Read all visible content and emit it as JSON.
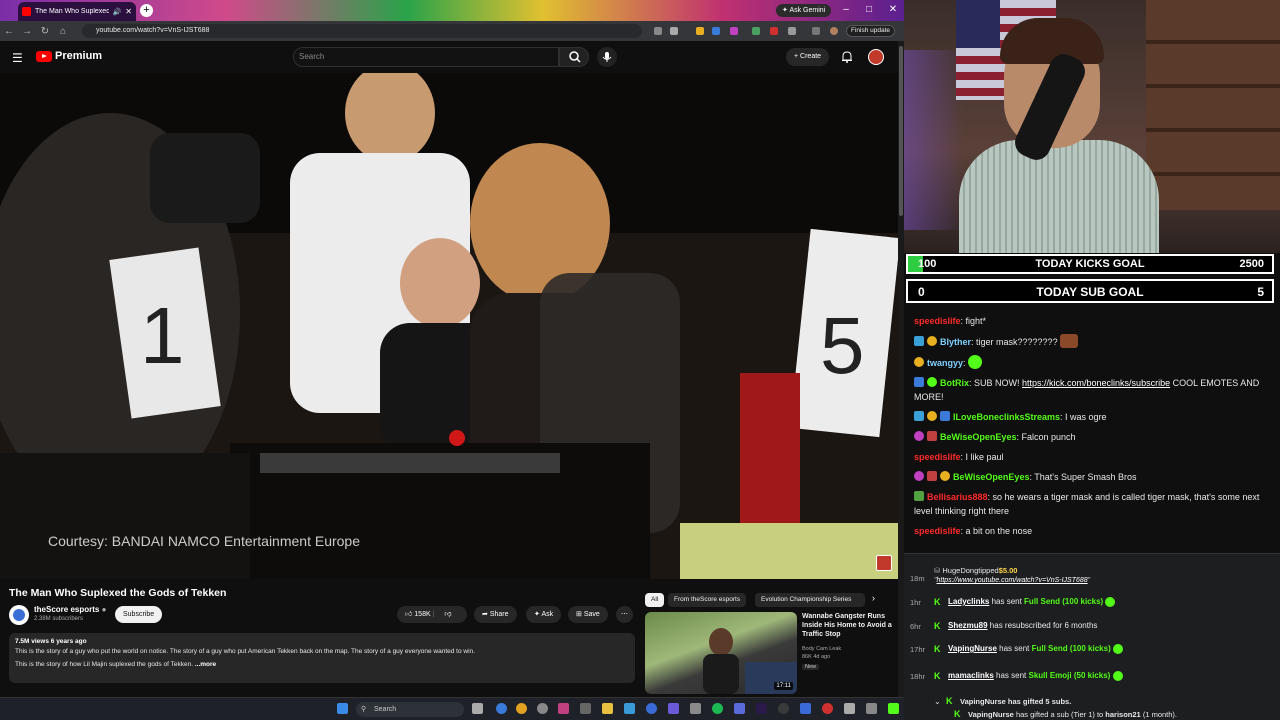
{
  "browser": {
    "tab_title": "The Man Who Suplexed the",
    "gemini_label": "Ask Gemini",
    "url": "youtube.com/watch?v=VnS-IJST688",
    "finish_update": "Finish update"
  },
  "youtube": {
    "logo_text": "Premium",
    "search_placeholder": "Search",
    "create_label": "Create",
    "video_overlay_text": "Courtesy: BANDAI NAMCO Entertainment Europe",
    "video_title": "The Man Who Suplexed the Gods of Tekken",
    "channel_name": "theScore esports",
    "channel_subs": "2.38M subscribers",
    "subscribe_label": "Subscribe",
    "like_count": "158K",
    "share_label": "Share",
    "ask_label": "Ask",
    "save_label": "Save",
    "desc_meta": "7.5M views  6 years ago",
    "desc_line1": "This is the story of a guy who put the world on notice. The story of a guy who put American Tekken back on the map. The story of a guy everyone wanted to win.",
    "desc_line2": "This is the story of how Lil Majin suplexed the gods of Tekken.",
    "desc_more": "...more",
    "chips": [
      "All",
      "From theScore esports",
      "Evolution Championship Series"
    ],
    "related": {
      "title": "Wannabe Gangster Runs Inside His Home to Avoid a Traffic Stop",
      "channel": "Body Cam Leak",
      "stats": "86K  4d ago",
      "badge": "New",
      "duration": "17:11"
    }
  },
  "taskbar": {
    "search_placeholder": "Search"
  },
  "goals": {
    "kicks": {
      "current": "100",
      "label": "TODAY KICKS GOAL",
      "target": "2500",
      "progress": 0.04
    },
    "subs": {
      "current": "0",
      "label": "TODAY SUB GOAL",
      "target": "5"
    }
  },
  "chat": [
    {
      "user": "speedislife",
      "color": "#ff2a2a",
      "text": ": fight*"
    },
    {
      "user": "Blyther",
      "color": "#7fd0ff",
      "text": ": tiger mask????????"
    },
    {
      "user": "twangyy",
      "color": "#7fd0ff",
      "text": ":"
    },
    {
      "user": "BotRix",
      "color": "#53fc18",
      "text": ": SUB NOW! ",
      "link": "https://kick.com/boneclinks/subscribe",
      "after": " COOL EMOTES AND MORE!"
    },
    {
      "user": "ILoveBoneclinksStreams",
      "color": "#53fc18",
      "text": ": I was ogre"
    },
    {
      "user": "BeWiseOpenEyes",
      "color": "#53fc18",
      "text": ": Falcon punch"
    },
    {
      "user": "speedislife",
      "color": "#ff2a2a",
      "text": ": I like paul"
    },
    {
      "user": "BeWiseOpenEyes",
      "color": "#53fc18",
      "text": ": That's Super Smash Bros"
    },
    {
      "user": "Bellisarius888",
      "color": "#ff2a2a",
      "text": ": so he wears a tiger mask and is called tiger mask, that's some next level thinking right there"
    },
    {
      "user": "speedislife",
      "color": "#ff2a2a",
      "text": ": a bit on the nose"
    }
  ],
  "events": {
    "tip": {
      "time": "18m",
      "user": "HugeDong",
      "verb": "tipped",
      "amount": "$5.00",
      "message": "https://www.youtube.com/watch?v=VnS-IJST688"
    },
    "items": [
      {
        "time": "1hr",
        "user": "Ladyclinks",
        "pre": " has sent ",
        "item": "Full Send (100 kicks)"
      },
      {
        "time": "6hr",
        "user": "Shezmu89",
        "pre": " has resubscribed for 6 months",
        "item": ""
      },
      {
        "time": "17hr",
        "user": "VapingNurse",
        "pre": " has sent ",
        "item": "Full Send (100 kicks)"
      },
      {
        "time": "18hr",
        "user": "mamaclinks",
        "pre": " has sent ",
        "item": "Skull Emoji (50 kicks)"
      }
    ],
    "gift_line1": "VapingNurse has gifted 5 subs.",
    "gift_line2_user": "VapingNurse",
    "gift_line2_text": " has gifted a sub (Tier 1) to ",
    "gift_line2_target": "harison21",
    "gift_line2_end": " (1 month)."
  },
  "colors": {
    "yt_red": "#ff0000",
    "kick_green": "#53fc18"
  }
}
